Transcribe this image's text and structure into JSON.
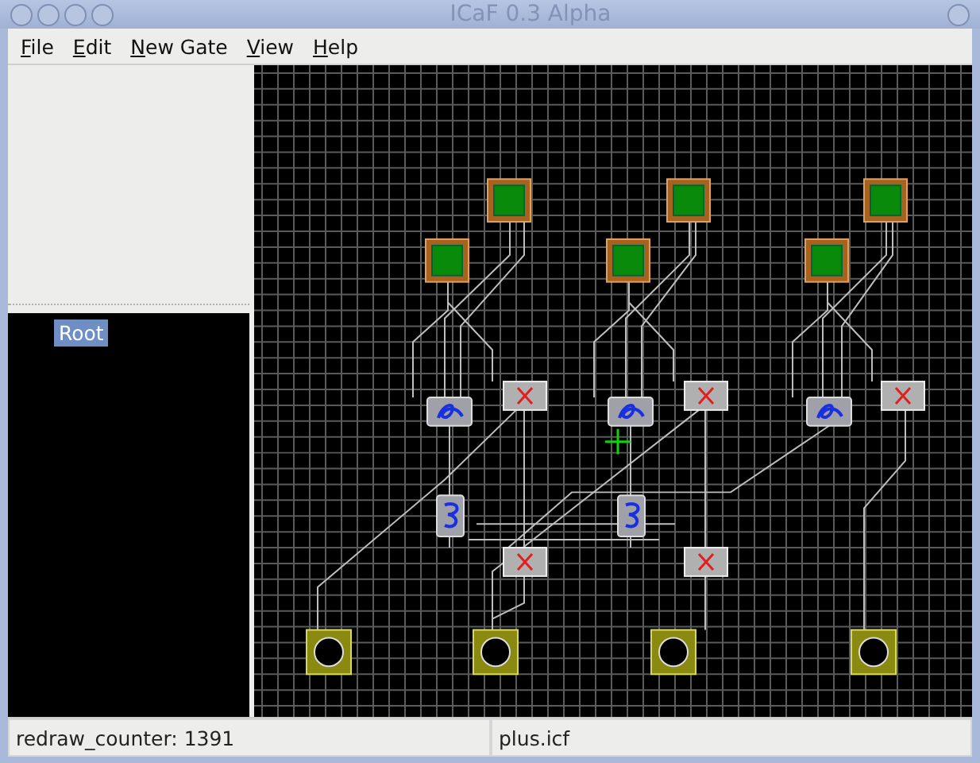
{
  "window": {
    "title": "ICaF 0.3 Alpha"
  },
  "menu": [
    {
      "label": "File"
    },
    {
      "label": "Edit"
    },
    {
      "label": "New Gate"
    },
    {
      "label": "View"
    },
    {
      "label": "Help"
    }
  ],
  "tree": {
    "items": [
      {
        "label": "Root",
        "selected": true
      }
    ]
  },
  "status_bar": [
    "redraw_counter: 1391",
    "plus.icf"
  ]
}
